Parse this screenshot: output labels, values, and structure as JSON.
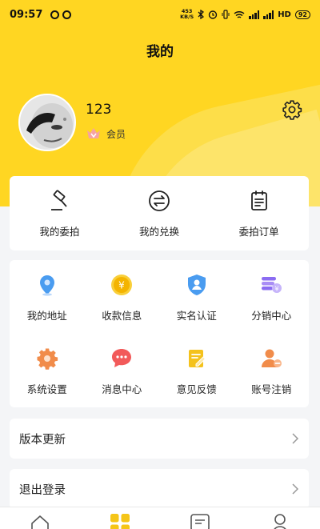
{
  "status_bar": {
    "time": "09:57",
    "net_speed_value": "453",
    "net_speed_unit": "KB/S",
    "network_label": "HD",
    "battery": "92"
  },
  "page": {
    "title": "我的"
  },
  "profile": {
    "username": "123",
    "member_label": "会员"
  },
  "quick_actions": [
    {
      "label": "我的委拍",
      "icon": "auction-hammer-icon"
    },
    {
      "label": "我的兑换",
      "icon": "exchange-icon"
    },
    {
      "label": "委拍订单",
      "icon": "order-clipboard-icon"
    }
  ],
  "services": [
    {
      "label": "我的地址",
      "icon": "location-pin-icon"
    },
    {
      "label": "收款信息",
      "icon": "yuan-coin-icon"
    },
    {
      "label": "实名认证",
      "icon": "id-shield-icon"
    },
    {
      "label": "分销中心",
      "icon": "coin-stack-icon"
    },
    {
      "label": "系统设置",
      "icon": "gear-icon"
    },
    {
      "label": "消息中心",
      "icon": "chat-bubble-icon"
    },
    {
      "label": "意见反馈",
      "icon": "edit-note-icon"
    },
    {
      "label": "账号注销",
      "icon": "user-remove-icon"
    }
  ],
  "menu_rows": [
    {
      "label": "版本更新"
    },
    {
      "label": "退出登录"
    }
  ],
  "tab_bar": [
    {
      "icon": "home-icon",
      "active": false
    },
    {
      "icon": "category-icon",
      "active": true
    },
    {
      "icon": "message-icon",
      "active": false
    },
    {
      "icon": "profile-icon",
      "active": false
    }
  ],
  "colors": {
    "brand_yellow": "#ffd622",
    "icon_blue": "#4a9cf0",
    "icon_gold": "#f4b400",
    "icon_purple": "#8b6cf2",
    "icon_orange": "#f18c4a",
    "icon_red": "#f25a5a"
  }
}
